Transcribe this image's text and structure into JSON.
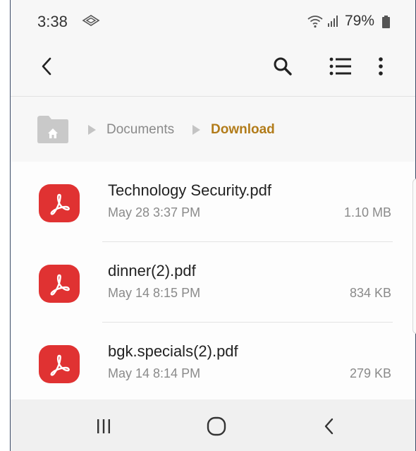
{
  "status_bar": {
    "time": "3:38",
    "battery_percent": "79%",
    "icons": [
      "cast-icon",
      "wifi-icon",
      "signal-icon",
      "battery-icon"
    ]
  },
  "app_bar": {
    "icons": [
      "back-arrow-icon",
      "search-icon",
      "list-view-icon",
      "more-vert-icon"
    ]
  },
  "breadcrumb": {
    "home_icon": "home-folder-icon",
    "items": [
      {
        "label": "Documents"
      },
      {
        "label": "Download"
      }
    ]
  },
  "files": [
    {
      "name": "Technology Security.pdf",
      "date": "May 28 3:37 PM",
      "size": "1.10 MB",
      "icon": "pdf-icon"
    },
    {
      "name": "dinner(2).pdf",
      "date": "May 14 8:15 PM",
      "size": "834 KB",
      "icon": "pdf-icon"
    },
    {
      "name": "bgk.specials(2).pdf",
      "date": "May 14 8:14 PM",
      "size": "279 KB",
      "icon": "pdf-icon"
    }
  ],
  "nav_bar": {
    "icons": [
      "recents-icon",
      "home-icon",
      "back-icon"
    ]
  },
  "colors": {
    "accent": "#b27c1a",
    "pdf_red": "#e03232",
    "secondary_text": "#8a8a8a"
  }
}
